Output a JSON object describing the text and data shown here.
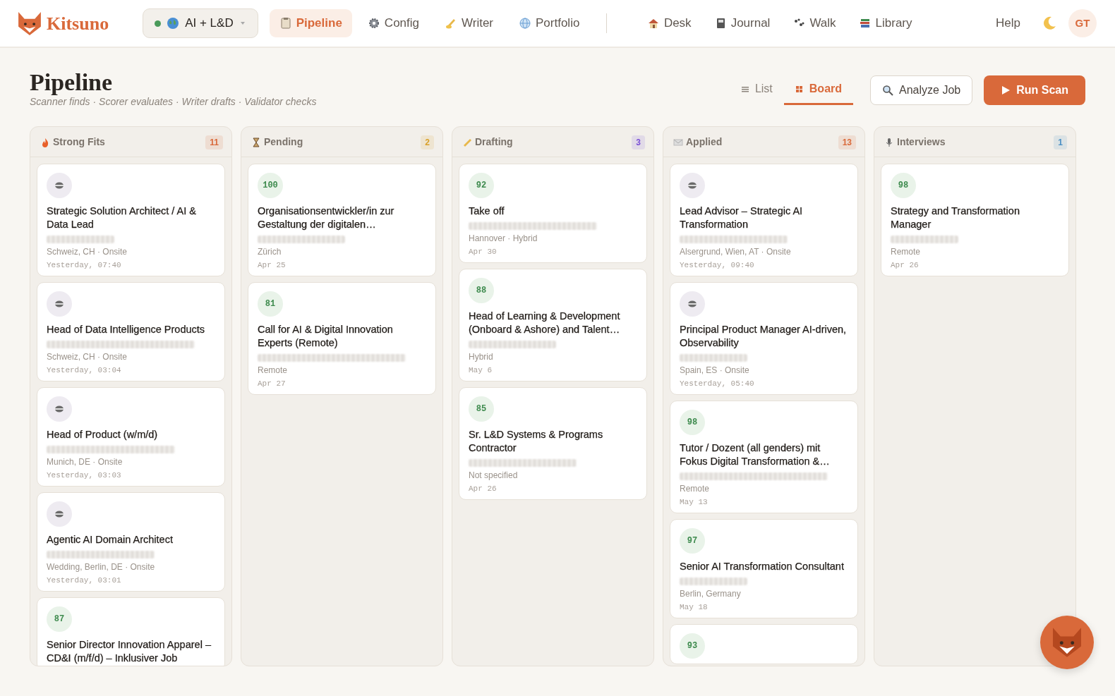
{
  "brand": {
    "name": "Kitsuno"
  },
  "workspace": {
    "label": "AI + L&D",
    "online": true
  },
  "nav": [
    {
      "label": "Pipeline",
      "selected": true
    },
    {
      "label": "Config",
      "selected": false
    },
    {
      "label": "Writer",
      "selected": false
    },
    {
      "label": "Portfolio",
      "selected": false
    }
  ],
  "nav_right": [
    {
      "label": "Desk"
    },
    {
      "label": "Journal"
    },
    {
      "label": "Walk"
    },
    {
      "label": "Library"
    }
  ],
  "help": "Help",
  "avatar": "GT",
  "page": {
    "title": "Pipeline",
    "subtitle": "Scanner finds · Scorer evaluates · Writer drafts · Validator checks"
  },
  "views": [
    {
      "label": "List",
      "selected": false
    },
    {
      "label": "Board",
      "selected": true
    }
  ],
  "actions": {
    "analyze": "Analyze Job",
    "run": "Run Scan"
  },
  "columns": [
    {
      "title": "Strong Fits",
      "count": "11",
      "color": "#d9693a",
      "cards": [
        {
          "kind": "logo",
          "title": "Strategic Solution Architect / AI & Data Lead",
          "company_blurred": true,
          "location": "Schweiz, CH · Onsite",
          "time": "Yesterday, 07:40"
        },
        {
          "kind": "logo",
          "title": "Head of Data Intelligence Products",
          "company_blurred": true,
          "location": "Schweiz, CH · Onsite",
          "time": "Yesterday, 03:04"
        },
        {
          "kind": "logo",
          "title": "Head of Product (w/m/d)",
          "company_blurred": true,
          "location": "Munich, DE · Onsite",
          "time": "Yesterday, 03:03"
        },
        {
          "kind": "logo",
          "title": "Agentic AI Domain Architect",
          "company_blurred": true,
          "location": "Wedding, Berlin, DE · Onsite",
          "time": "Yesterday, 03:01"
        },
        {
          "kind": "score",
          "score": "87",
          "title": "Senior Director Innovation Apparel – CD&I (m/f/d) – Inklusiver Job"
        }
      ]
    },
    {
      "title": "Pending",
      "count": "2",
      "color": "#d9a12a",
      "cards": [
        {
          "kind": "score",
          "score": "100",
          "title": "Organisationsentwickler/in zur Gestaltung der digitalen…",
          "company_blurred": true,
          "location": "Zürich",
          "time": "Apr 25"
        },
        {
          "kind": "score",
          "score": "81",
          "title": "Call for AI & Digital Innovation Experts (Remote)",
          "company_blurred": true,
          "location": "Remote",
          "time": "Apr 27"
        }
      ]
    },
    {
      "title": "Drafting",
      "count": "3",
      "color": "#7a4fd6",
      "cards": [
        {
          "kind": "score",
          "score": "92",
          "title": "Take off",
          "company_blurred": true,
          "location": "Hannover · Hybrid",
          "time": "Apr 30"
        },
        {
          "kind": "score",
          "score": "88",
          "title": "Head of Learning & Development (Onboard & Ashore) and Talent…",
          "company_blurred": true,
          "location": "Hybrid",
          "time": "May 6"
        },
        {
          "kind": "score",
          "score": "85",
          "title": "Sr. L&D Systems & Programs Contractor",
          "company_blurred": true,
          "location": "Not specified",
          "time": "Apr 26"
        }
      ]
    },
    {
      "title": "Applied",
      "count": "13",
      "color": "#d9693a",
      "cards": [
        {
          "kind": "logo",
          "title": "Lead Advisor – Strategic AI Transformation",
          "company_blurred": true,
          "location": "Alsergrund, Wien, AT · Onsite",
          "time": "Yesterday, 09:40"
        },
        {
          "kind": "logo",
          "title": "Principal Product Manager AI-driven, Observability",
          "company_blurred": true,
          "location": "Spain, ES · Onsite",
          "time": "Yesterday, 05:40"
        },
        {
          "kind": "score",
          "score": "98",
          "title": "Tutor / Dozent (all genders) mit Fokus Digital Transformation &…",
          "company_blurred": true,
          "location": "Remote",
          "time": "May 13"
        },
        {
          "kind": "score",
          "score": "97",
          "title": "Senior AI Transformation Consultant",
          "company_blurred": true,
          "location": "Berlin, Germany",
          "time": "May 18"
        },
        {
          "kind": "score",
          "score": "93"
        }
      ]
    },
    {
      "title": "Interviews",
      "count": "1",
      "color": "#4a8fc4",
      "cards": [
        {
          "kind": "score",
          "score": "98",
          "title": "Strategy and Transformation Manager",
          "company_blurred": true,
          "location": "Remote",
          "time": "Apr 26"
        }
      ]
    }
  ]
}
